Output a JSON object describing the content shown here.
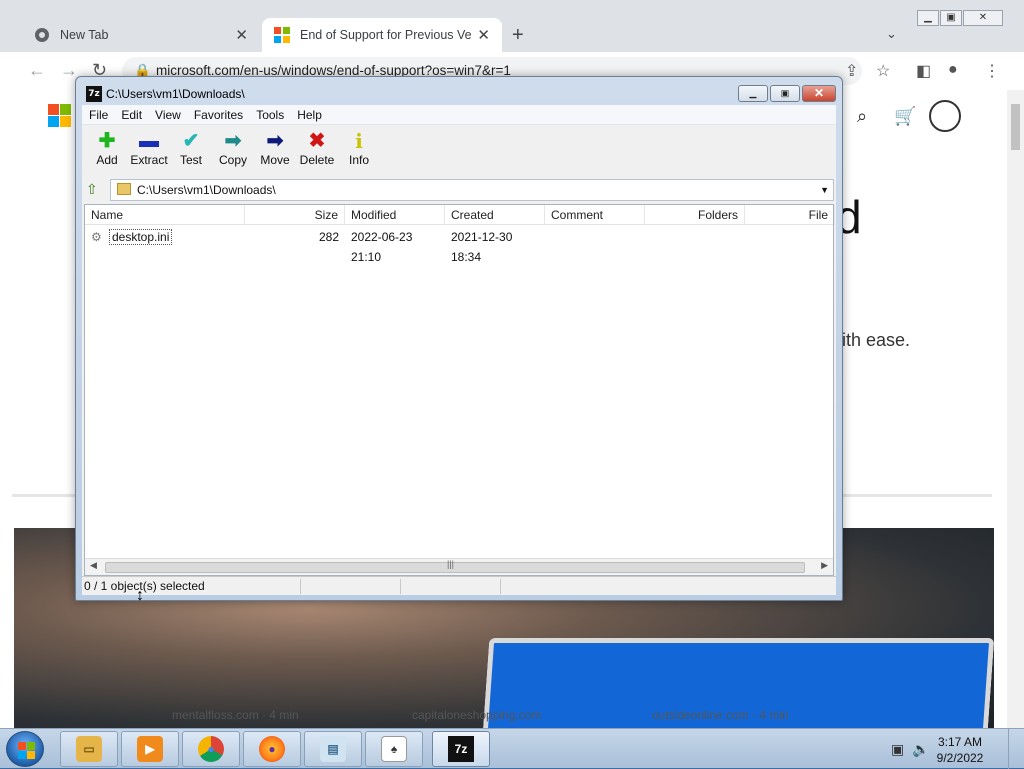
{
  "browser": {
    "tabs": [
      {
        "title": "New Tab",
        "active": false
      },
      {
        "title": "End of Support for Previous Versi",
        "active": true
      }
    ],
    "url": "microsoft.com/en-us/windows/end-of-support?os=win7&r=1",
    "icons": [
      "back-icon",
      "forward-icon",
      "reload-icon",
      "lock-icon",
      "share-icon",
      "bookmark-star-icon",
      "side-panel-icon",
      "profile-icon",
      "menu-icon"
    ]
  },
  "page": {
    "heading_fragment": "d",
    "subtext_fragment": "ith ease.",
    "bottom_links": [
      "mentalfloss.com · 4 min",
      "capitaloneshopping.com",
      "outsideonline.com · 4 min"
    ],
    "colors": {
      "ms_red": "#f25022",
      "ms_green": "#7fba00",
      "ms_blue": "#00a4ef",
      "ms_yellow": "#ffb900"
    }
  },
  "zip": {
    "title": "C:\\Users\\vm1\\Downloads\\",
    "app_icon_label": "7z",
    "menu": [
      "File",
      "Edit",
      "View",
      "Favorites",
      "Tools",
      "Help"
    ],
    "toolbar": [
      {
        "label": "Add",
        "glyph": "✚",
        "color": "#1fb51f",
        "icon": "add-icon"
      },
      {
        "label": "Extract",
        "glyph": "▬",
        "color": "#1a2fb8",
        "icon": "extract-icon"
      },
      {
        "label": "Test",
        "glyph": "✔",
        "color": "#25b7b7",
        "icon": "test-icon"
      },
      {
        "label": "Copy",
        "glyph": "➡",
        "color": "#1f8a8a",
        "icon": "copy-icon"
      },
      {
        "label": "Move",
        "glyph": "➡",
        "color": "#0d1a7a",
        "icon": "move-icon"
      },
      {
        "label": "Delete",
        "glyph": "✖",
        "color": "#d01515",
        "icon": "delete-icon"
      },
      {
        "label": "Info",
        "glyph": "i",
        "color": "#c9c300",
        "icon": "info-icon"
      }
    ],
    "address": "C:\\Users\\vm1\\Downloads\\",
    "columns": [
      "Name",
      "Size",
      "Modified",
      "Created",
      "Comment",
      "Folders",
      "File"
    ],
    "rows": [
      {
        "name": "desktop.ini",
        "size": "282",
        "modified": "2022-06-23 21:10",
        "created": "2021-12-30 18:34",
        "comment": "",
        "folders": ""
      }
    ],
    "status": "0 / 1 object(s) selected"
  },
  "taskbar": {
    "apps": [
      {
        "name": "explorer",
        "glyph": "▭",
        "color": "#e6b54a"
      },
      {
        "name": "media-player",
        "glyph": "▶",
        "color": "#f08a1c"
      },
      {
        "name": "chrome",
        "glyph": "●",
        "color": "#db4437"
      },
      {
        "name": "firefox",
        "glyph": "●",
        "color": "#ff7a1a"
      },
      {
        "name": "notepad",
        "glyph": "▤",
        "color": "#7fb2d6"
      },
      {
        "name": "solitaire",
        "glyph": "♠",
        "color": "#333333"
      },
      {
        "name": "7zip",
        "glyph": "7z",
        "color": "#111111"
      }
    ],
    "time": "3:17 AM",
    "date": "9/2/2022"
  }
}
